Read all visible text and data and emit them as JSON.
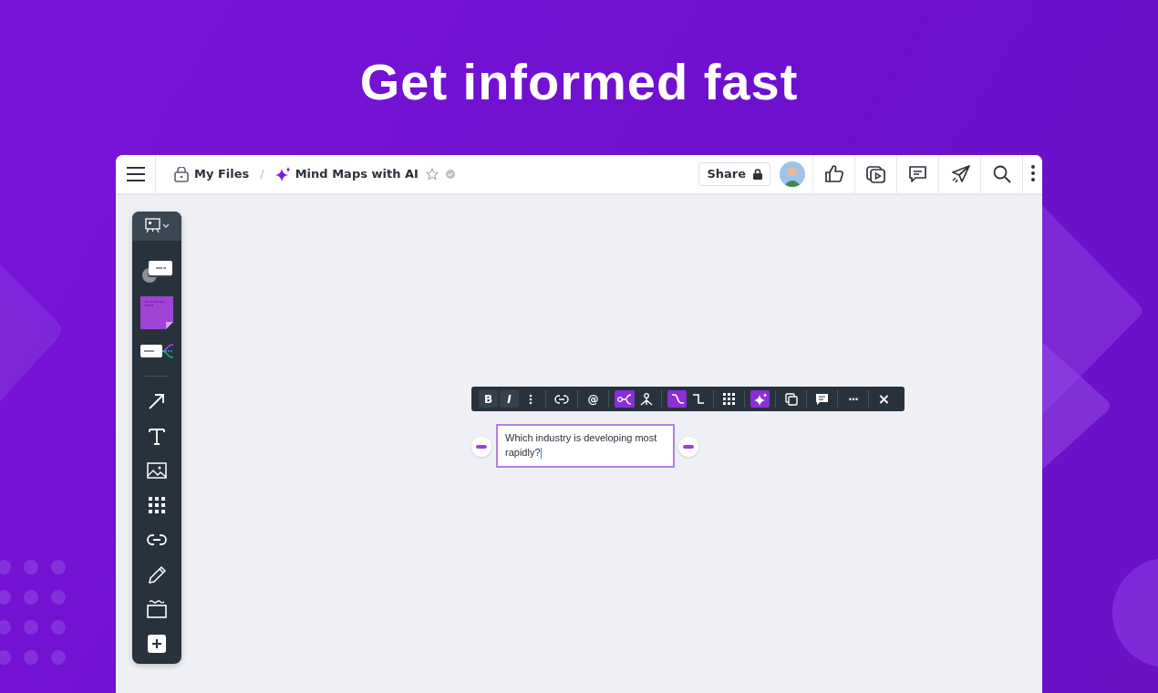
{
  "headline": "Get informed fast",
  "header": {
    "breadcrumb": [
      {
        "kind": "folder",
        "label": "My Files"
      },
      {
        "kind": "board",
        "label": "Mind Maps with AI"
      }
    ],
    "separator": "/",
    "starred": false,
    "share": {
      "label": "Share"
    },
    "actions": [
      {
        "kind": "like"
      },
      {
        "kind": "present"
      },
      {
        "kind": "comment"
      },
      {
        "kind": "send"
      },
      {
        "kind": "search"
      },
      {
        "kind": "more"
      }
    ]
  },
  "tools": [
    {
      "kind": "presentation"
    },
    {
      "kind": "shapes"
    },
    {
      "kind": "sticky"
    },
    {
      "kind": "mindmap"
    },
    {
      "kind": "divider"
    },
    {
      "kind": "arrow"
    },
    {
      "kind": "text"
    },
    {
      "kind": "image"
    },
    {
      "kind": "grid"
    },
    {
      "kind": "link"
    },
    {
      "kind": "pen"
    },
    {
      "kind": "frame"
    },
    {
      "kind": "plus"
    }
  ],
  "format_toolbar": [
    [
      {
        "kind": "bold",
        "label": "B",
        "selected": false
      },
      {
        "kind": "italic",
        "label": "I",
        "selected": false
      },
      {
        "kind": "dots",
        "selected": false
      }
    ],
    [
      {
        "kind": "link",
        "selected": false
      }
    ],
    [
      {
        "kind": "mention",
        "label": "@",
        "selected": false
      }
    ],
    [
      {
        "kind": "branch",
        "selected": true
      },
      {
        "kind": "tree",
        "selected": false
      }
    ],
    [
      {
        "kind": "curve",
        "selected": true
      },
      {
        "kind": "elbow",
        "selected": false
      }
    ],
    [
      {
        "kind": "grid",
        "selected": false
      }
    ],
    [
      {
        "kind": "ai",
        "selected": true
      }
    ],
    [
      {
        "kind": "duplicate",
        "selected": false
      }
    ],
    [
      {
        "kind": "comment",
        "selected": false
      }
    ],
    [
      {
        "kind": "more",
        "label": "···",
        "selected": false
      }
    ],
    [
      {
        "kind": "close",
        "label": "×",
        "selected": false
      }
    ]
  ],
  "node": {
    "text": "Which industry is developing most rapidly?",
    "editing": true
  }
}
